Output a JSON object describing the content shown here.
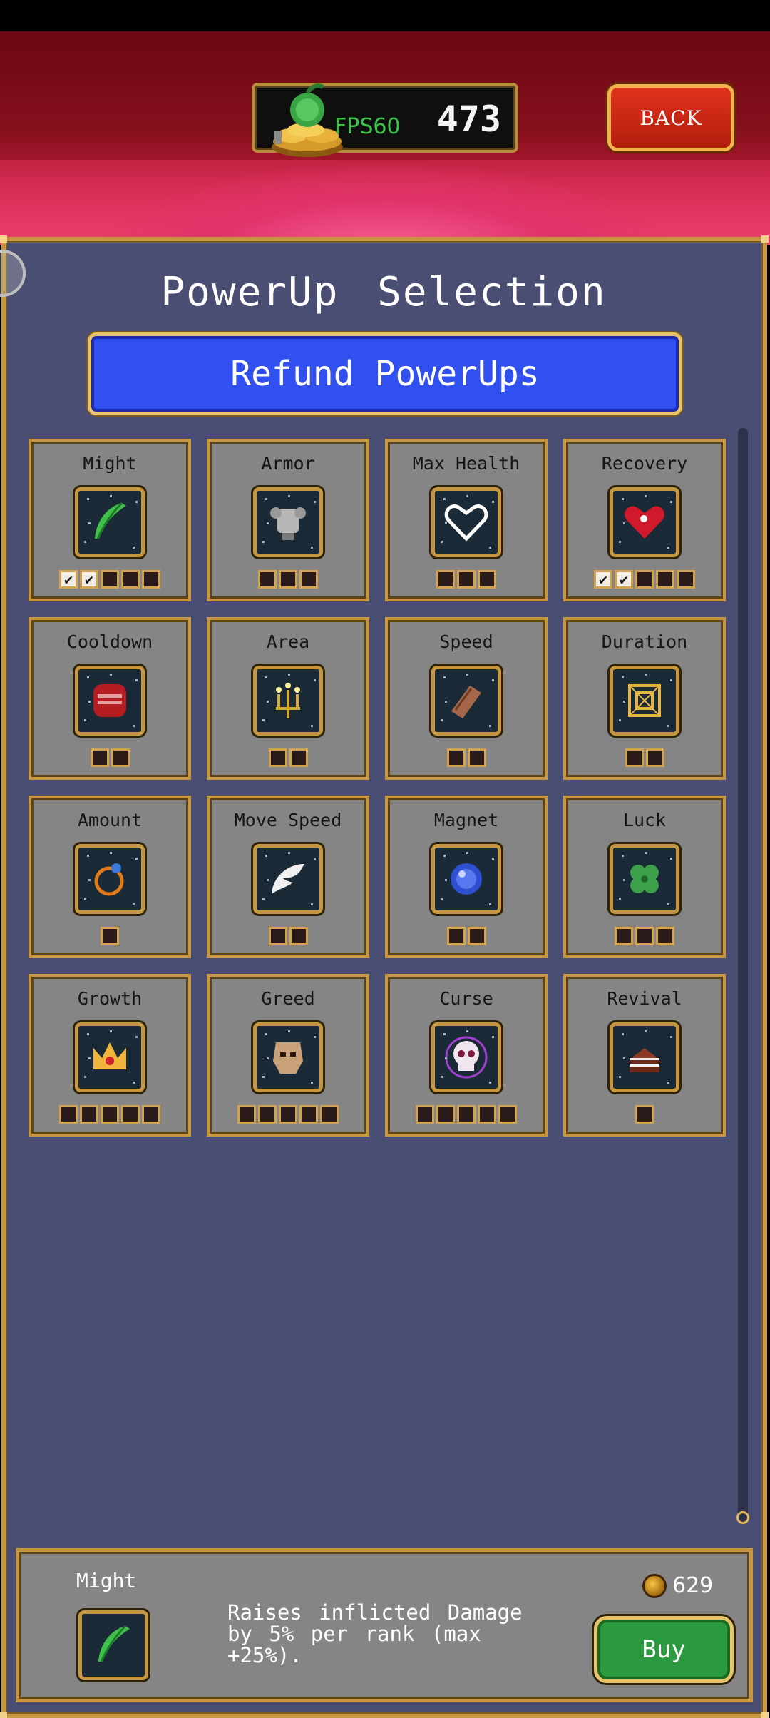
{
  "header": {
    "fps_label": "FPS60",
    "coins": "473",
    "back_label": "BACK"
  },
  "panel": {
    "title": "PowerUp Selection",
    "refund_label": "Refund PowerUps"
  },
  "powerups": [
    {
      "label": "Might",
      "icon": "feather-icon",
      "ranks": 5,
      "bought": 2
    },
    {
      "label": "Armor",
      "icon": "armor-icon",
      "ranks": 3,
      "bought": 0
    },
    {
      "label": "Max Health",
      "icon": "heart-outline-icon",
      "ranks": 3,
      "bought": 0
    },
    {
      "label": "Recovery",
      "icon": "heart-icon",
      "ranks": 5,
      "bought": 2
    },
    {
      "label": "Cooldown",
      "icon": "tome-icon",
      "ranks": 2,
      "bought": 0
    },
    {
      "label": "Area",
      "icon": "candelabra-icon",
      "ranks": 2,
      "bought": 0
    },
    {
      "label": "Speed",
      "icon": "bracer-icon",
      "ranks": 2,
      "bought": 0
    },
    {
      "label": "Duration",
      "icon": "spellbinder-icon",
      "ranks": 2,
      "bought": 0
    },
    {
      "label": "Amount",
      "icon": "ring-icon",
      "ranks": 1,
      "bought": 0
    },
    {
      "label": "Move Speed",
      "icon": "wings-icon",
      "ranks": 2,
      "bought": 0
    },
    {
      "label": "Magnet",
      "icon": "orb-icon",
      "ranks": 2,
      "bought": 0
    },
    {
      "label": "Luck",
      "icon": "clover-icon",
      "ranks": 3,
      "bought": 0
    },
    {
      "label": "Growth",
      "icon": "crown-icon",
      "ranks": 5,
      "bought": 0
    },
    {
      "label": "Greed",
      "icon": "mask-icon",
      "ranks": 5,
      "bought": 0
    },
    {
      "label": "Curse",
      "icon": "skull-icon",
      "ranks": 5,
      "bought": 0
    },
    {
      "label": "Revival",
      "icon": "cake-icon",
      "ranks": 1,
      "bought": 0
    }
  ],
  "selected": {
    "name": "Might",
    "icon": "feather-icon",
    "description": "Raises inflicted Damage by 5% per rank (max +25%).",
    "price": "629",
    "buy_label": "Buy"
  },
  "colors": {
    "panel_bg": "#4b4e73",
    "card_bg": "#858585",
    "gold_border": "#c69740",
    "refund_blue": "#3150f0",
    "buy_green": "#2b9a3e",
    "back_red": "#d0281a"
  }
}
